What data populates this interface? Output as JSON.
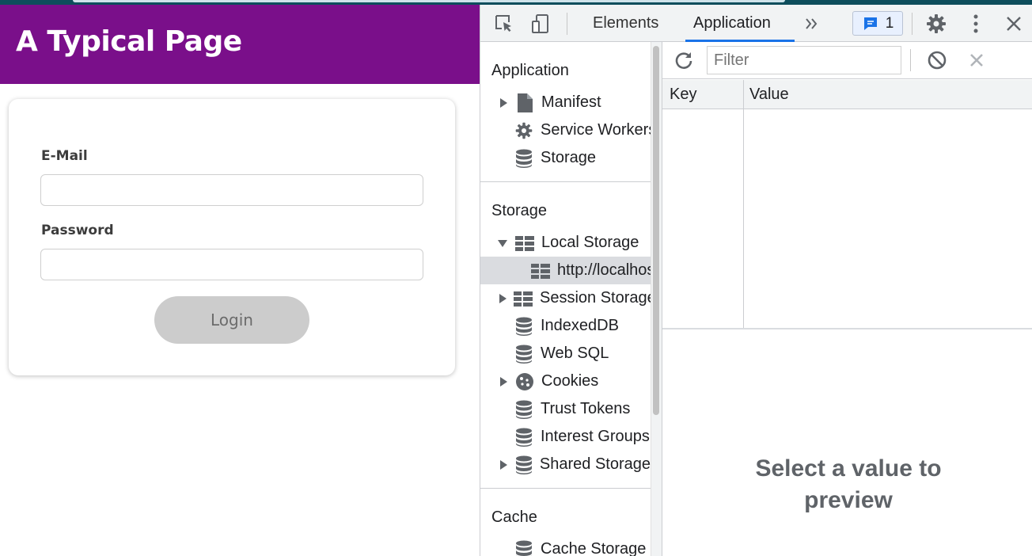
{
  "page": {
    "title": "A Typical Page",
    "email_label": "E-Mail",
    "email_value": "",
    "password_label": "Password",
    "password_value": "",
    "login_label": "Login"
  },
  "devtools": {
    "tabs": [
      {
        "label": "Elements"
      },
      {
        "label": "Application"
      }
    ],
    "issues_count": "1",
    "sidebar": {
      "application_title": "Application",
      "application_items": [
        {
          "label": "Manifest",
          "icon": "document-icon"
        },
        {
          "label": "Service Workers",
          "icon": "gear-icon"
        },
        {
          "label": "Storage",
          "icon": "database-icon"
        }
      ],
      "storage_title": "Storage",
      "storage_items": [
        {
          "label": "Local Storage",
          "icon": "grid-icon"
        },
        {
          "label": "http://localhost",
          "icon": "grid-icon"
        },
        {
          "label": "Session Storage",
          "icon": "grid-icon"
        },
        {
          "label": "IndexedDB",
          "icon": "database-icon"
        },
        {
          "label": "Web SQL",
          "icon": "database-icon"
        },
        {
          "label": "Cookies",
          "icon": "cookie-icon"
        },
        {
          "label": "Trust Tokens",
          "icon": "database-icon"
        },
        {
          "label": "Interest Groups",
          "icon": "database-icon"
        },
        {
          "label": "Shared Storage",
          "icon": "database-icon"
        }
      ],
      "cache_title": "Cache",
      "cache_items": [
        {
          "label": "Cache Storage",
          "icon": "database-icon"
        }
      ]
    },
    "filter_placeholder": "Filter",
    "columns": [
      "Key",
      "Value"
    ],
    "preview_text": "Select a value to preview"
  },
  "colors": {
    "header_purple": "#7a0f8a",
    "devtools_accent": "#1a73e8",
    "login_disabled": "#cccccc"
  }
}
